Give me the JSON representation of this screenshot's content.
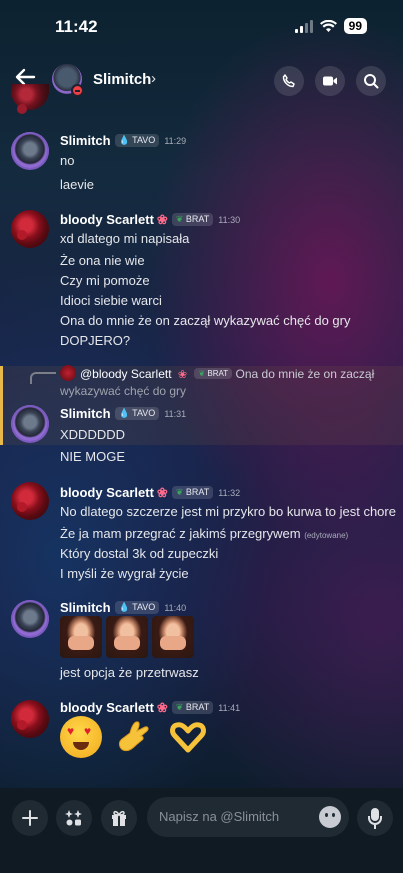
{
  "status": {
    "time": "11:42",
    "battery": "99"
  },
  "header": {
    "name": "Slimitch",
    "chevron": "›"
  },
  "tags": {
    "tavo": "TAVO",
    "brat": "BRAT"
  },
  "messages": [
    {
      "author": "Slimitch",
      "time": "11:29",
      "lines": [
        "no",
        "laevie"
      ]
    },
    {
      "author": "bloody Scarlett",
      "time": "11:30",
      "lines": [
        "xd dlatego mi napisała",
        "Że ona nie wie",
        "Czy mi pomoże",
        "Idioci siebie warci",
        "Ona do mnie że on zaczął wykazywać chęć do gry",
        "DOPJERO?"
      ]
    },
    {
      "author": "Slimitch",
      "time": "11:31",
      "lines": [
        "XDDDDDD",
        "NIE MOGE"
      ],
      "reply": {
        "mention": "@bloody Scarlett",
        "text": "Ona do mnie że on zaczął",
        "text2": "wykazywać chęć do gry"
      }
    },
    {
      "author": "bloody Scarlett",
      "time": "11:32",
      "lines": [
        "No dlatego szczerze jest mi przykro bo kurwa to jest chore",
        "Że ja mam przegrać z jakimś przegrywem",
        "Który dostal 3k od zupeczki",
        "I myśli że wygrał życie"
      ],
      "edited": "(edytowane)"
    },
    {
      "author": "Slimitch",
      "time": "11:40",
      "lines": [
        "jest opcja że przetrwasz"
      ]
    },
    {
      "author": "bloody Scarlett",
      "time": "11:41",
      "lines": []
    }
  ],
  "composer": {
    "placeholder": "Napisz na @Slimitch"
  },
  "icons": [
    "back-arrow-icon",
    "phone-icon",
    "video-icon",
    "search-icon",
    "plus-icon",
    "apps-icon",
    "gift-icon",
    "emoji-icon",
    "mic-icon"
  ]
}
